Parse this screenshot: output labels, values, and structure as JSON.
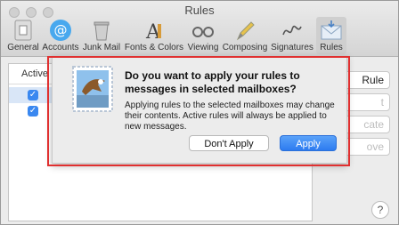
{
  "window": {
    "title": "Rules"
  },
  "toolbar": {
    "items": [
      {
        "label": "General",
        "icon": "general-icon"
      },
      {
        "label": "Accounts",
        "icon": "at-sign-icon"
      },
      {
        "label": "Junk Mail",
        "icon": "trash-icon"
      },
      {
        "label": "Fonts & Colors",
        "icon": "fonts-icon"
      },
      {
        "label": "Viewing",
        "icon": "glasses-icon"
      },
      {
        "label": "Composing",
        "icon": "pencil-icon"
      },
      {
        "label": "Signatures",
        "icon": "signature-icon"
      },
      {
        "label": "Rules",
        "icon": "rules-envelope-icon",
        "selected": true
      }
    ]
  },
  "rules_list": {
    "column_header": "Active"
  },
  "side_buttons": {
    "add_label": "Rule",
    "edit_label": "t",
    "duplicate_label": "cate",
    "remove_label": "ove"
  },
  "help": {
    "label": "?"
  },
  "dialog": {
    "headline": "Do you want to apply your rules to messages in selected mailboxes?",
    "info": "Applying rules to the selected mailboxes may change their contents. Active rules will always be applied to new messages.",
    "cancel_label": "Don't Apply",
    "confirm_label": "Apply"
  }
}
